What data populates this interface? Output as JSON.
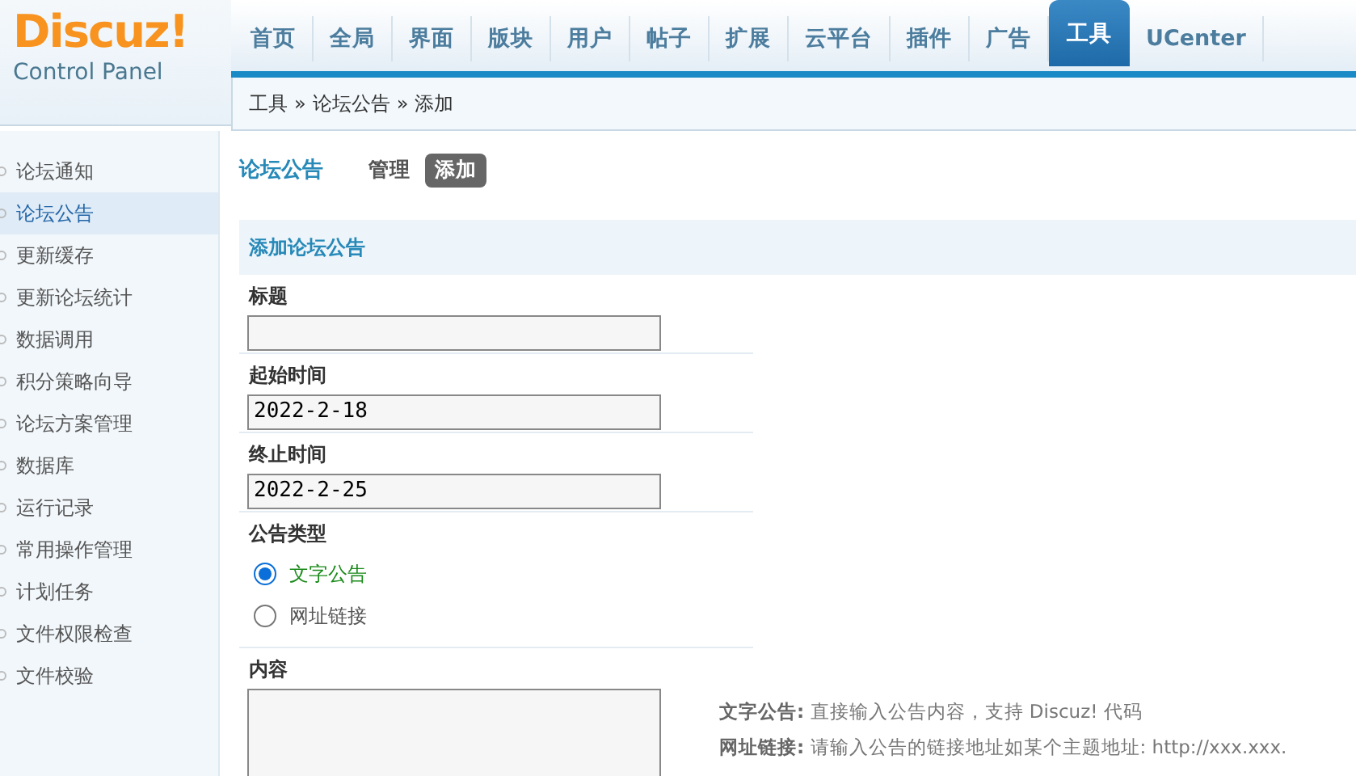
{
  "logo": {
    "brand": "Discuz!",
    "subtitle": "Control Panel"
  },
  "nav": [
    {
      "label": "首页",
      "selected": false
    },
    {
      "label": "全局",
      "selected": false
    },
    {
      "label": "界面",
      "selected": false
    },
    {
      "label": "版块",
      "selected": false
    },
    {
      "label": "用户",
      "selected": false
    },
    {
      "label": "帖子",
      "selected": false
    },
    {
      "label": "扩展",
      "selected": false
    },
    {
      "label": "云平台",
      "selected": false
    },
    {
      "label": "插件",
      "selected": false
    },
    {
      "label": "广告",
      "selected": false
    },
    {
      "label": "工具",
      "selected": true
    },
    {
      "label": "UCenter",
      "selected": false
    }
  ],
  "breadcrumb": [
    "工具",
    "»",
    "论坛公告",
    "»",
    "添加"
  ],
  "sidebar": {
    "items": [
      {
        "label": "论坛通知",
        "selected": false
      },
      {
        "label": "论坛公告",
        "selected": true
      },
      {
        "label": "更新缓存",
        "selected": false
      },
      {
        "label": "更新论坛统计",
        "selected": false
      },
      {
        "label": "数据调用",
        "selected": false
      },
      {
        "label": "积分策略向导",
        "selected": false
      },
      {
        "label": "论坛方案管理",
        "selected": false
      },
      {
        "label": "数据库",
        "selected": false
      },
      {
        "label": "运行记录",
        "selected": false
      },
      {
        "label": "常用操作管理",
        "selected": false
      },
      {
        "label": "计划任务",
        "selected": false
      },
      {
        "label": "文件权限检查",
        "selected": false
      },
      {
        "label": "文件校验",
        "selected": false
      }
    ]
  },
  "page_title": "论坛公告",
  "subtabs": [
    {
      "label": "管理",
      "selected": false
    },
    {
      "label": "添加",
      "selected": true
    }
  ],
  "form": {
    "section_title": "添加论坛公告",
    "fields": [
      {
        "kind": "text",
        "label": "标题"
      },
      {
        "kind": "text",
        "label": "起始时间",
        "value": "2022-2-18"
      },
      {
        "kind": "text",
        "label": "终止时间",
        "value": "2022-2-25"
      },
      {
        "kind": "radio",
        "label": "公告类型",
        "options": [
          {
            "label": "文字公告",
            "selected": true
          },
          {
            "label": "网址链接",
            "selected": false
          }
        ]
      },
      {
        "kind": "textarea",
        "label": "内容",
        "hints": [
          "**文字公告:** 直接输入公告内容，支持 Discuz! 代码",
          "**网址链接:** 请输入公告的链接地址如某个主题地址: http://xxx.xxx."
        ]
      }
    ]
  }
}
